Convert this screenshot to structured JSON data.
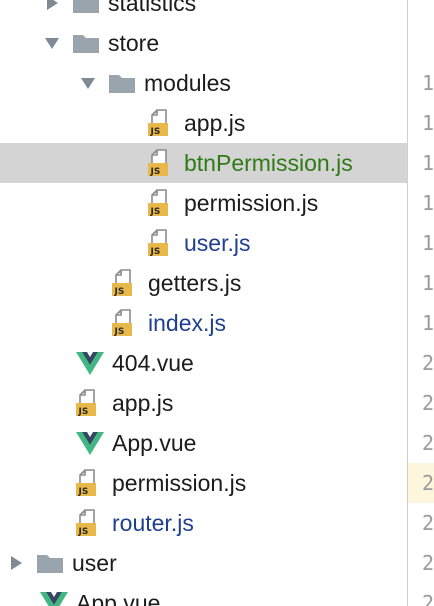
{
  "tree": {
    "rows": [
      {
        "label": "statistics",
        "kind": "folder",
        "arrow": "collapsed",
        "vcs": "none",
        "icon_name": "folder-icon"
      },
      {
        "label": "store",
        "kind": "folder",
        "arrow": "expanded",
        "vcs": "none",
        "icon_name": "folder-icon"
      },
      {
        "label": "modules",
        "kind": "folder",
        "arrow": "expanded",
        "vcs": "none",
        "icon_name": "folder-icon"
      },
      {
        "label": "app.js",
        "kind": "js",
        "arrow": "none",
        "vcs": "none",
        "icon_name": "js-file-icon"
      },
      {
        "label": "btnPermission.js",
        "kind": "js",
        "arrow": "none",
        "vcs": "added",
        "selected": true,
        "icon_name": "js-file-icon"
      },
      {
        "label": "permission.js",
        "kind": "js",
        "arrow": "none",
        "vcs": "none",
        "icon_name": "js-file-icon"
      },
      {
        "label": "user.js",
        "kind": "js",
        "arrow": "none",
        "vcs": "modified",
        "icon_name": "js-file-icon"
      },
      {
        "label": "getters.js",
        "kind": "js",
        "arrow": "none",
        "vcs": "none",
        "icon_name": "js-file-icon"
      },
      {
        "label": "index.js",
        "kind": "js",
        "arrow": "none",
        "vcs": "modified",
        "icon_name": "js-file-icon"
      },
      {
        "label": "404.vue",
        "kind": "vue",
        "arrow": "none",
        "vcs": "none",
        "icon_name": "vue-file-icon"
      },
      {
        "label": "app.js",
        "kind": "js",
        "arrow": "none",
        "vcs": "none",
        "icon_name": "js-file-icon"
      },
      {
        "label": "App.vue",
        "kind": "vue",
        "arrow": "none",
        "vcs": "none",
        "icon_name": "vue-file-icon"
      },
      {
        "label": "permission.js",
        "kind": "js",
        "arrow": "none",
        "vcs": "none",
        "icon_name": "js-file-icon"
      },
      {
        "label": "router.js",
        "kind": "js",
        "arrow": "none",
        "vcs": "modified",
        "icon_name": "js-file-icon"
      },
      {
        "label": "user",
        "kind": "folder",
        "arrow": "collapsed",
        "vcs": "none",
        "icon_name": "folder-icon"
      },
      {
        "label": "App.vue",
        "kind": "vue",
        "arrow": "none",
        "vcs": "none",
        "icon_name": "vue-file-icon"
      }
    ]
  },
  "gutter": {
    "lines": [
      "",
      "",
      "1",
      "1",
      "1",
      "1",
      "1",
      "1",
      "1",
      "2",
      "2",
      "2",
      "2",
      "2",
      "2",
      "2"
    ],
    "current_index": 12
  },
  "colors": {
    "selection": "#d4d4d4",
    "vcs_modified": "#1f3f8f",
    "vcs_added": "#2f7a17",
    "folder": "#9aa4ad",
    "js_badge": "#e8b84a",
    "vue_green": "#41b883",
    "vue_dark": "#35495e",
    "current_line": "#fbf6dc"
  }
}
